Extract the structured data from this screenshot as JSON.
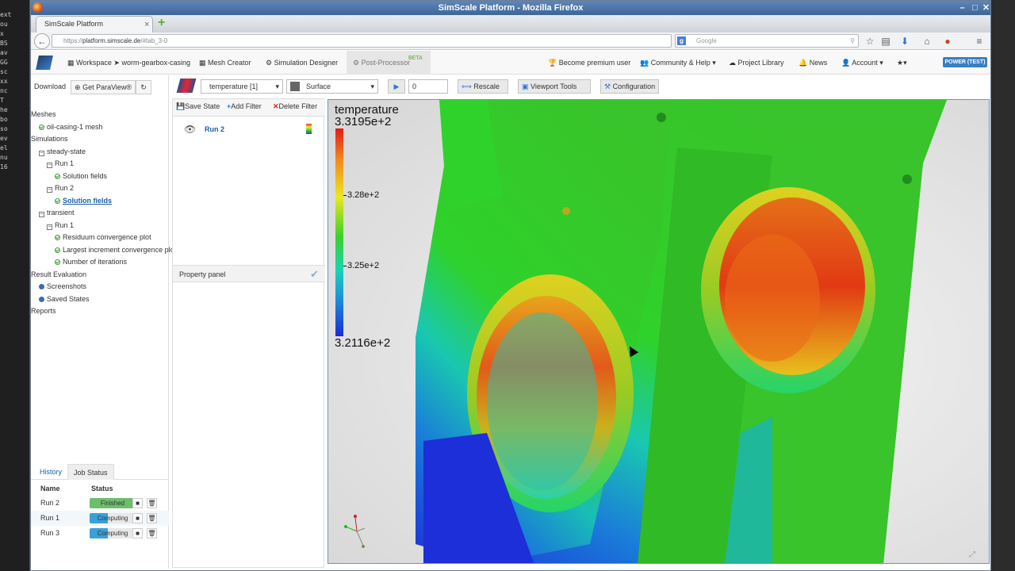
{
  "terminal_strip": {
    "lines": [
      "ext",
      "ou",
      "x",
      "BS",
      "av",
      "GG",
      "sc",
      "xx",
      "nc",
      "T",
      "he",
      "bo",
      "so",
      "ev",
      "el",
      "nu",
      "16"
    ]
  },
  "browser": {
    "window_title": "SimScale Platform - Mozilla Firefox",
    "tab_title": "SimScale Platform",
    "url_prefix": "https://",
    "url_domain": "platform.simscale.de",
    "url_path": "/#tab_3-0",
    "search_placeholder": "Google"
  },
  "app_nav": {
    "workspace_label": "Workspace",
    "arrow": "➤",
    "project_name": "worm-gearbox-casing",
    "mesh_creator": "Mesh Creator",
    "simulation_designer": "Simulation Designer",
    "post_processor": "Post-Processor",
    "beta_badge": "BETA",
    "premium": "Become premium user",
    "community": "Community & Help",
    "project_library": "Project Library",
    "news": "News",
    "account": "Account",
    "plan_badge": "POWER (TEST)"
  },
  "left_panel": {
    "download": "Download",
    "get_paraview": "Get ParaView®",
    "tree": [
      {
        "label": "Meshes",
        "indent": 0,
        "icon": "none"
      },
      {
        "label": "oil-casing-1 mesh",
        "indent": 1,
        "icon": "ok"
      },
      {
        "label": "Simulations",
        "indent": 0,
        "icon": "none"
      },
      {
        "label": "steady-state",
        "indent": 1,
        "icon": "minus"
      },
      {
        "label": "Run 1",
        "indent": 2,
        "icon": "minus"
      },
      {
        "label": "Solution fields",
        "indent": 3,
        "icon": "ok"
      },
      {
        "label": "Run 2",
        "indent": 2,
        "icon": "minus"
      },
      {
        "label": "Solution fields",
        "indent": 3,
        "icon": "ok",
        "selected": true
      },
      {
        "label": "transient",
        "indent": 1,
        "icon": "minus"
      },
      {
        "label": "Run 1",
        "indent": 2,
        "icon": "minus"
      },
      {
        "label": "Residuum convergence plot",
        "indent": 3,
        "icon": "ok"
      },
      {
        "label": "Largest increment convergence plot",
        "indent": 3,
        "icon": "ok"
      },
      {
        "label": "Number of iterations",
        "indent": 3,
        "icon": "ok"
      },
      {
        "label": "Result Evaluation",
        "indent": 0,
        "icon": "none"
      },
      {
        "label": "Screenshots",
        "indent": 1,
        "icon": "dot"
      },
      {
        "label": "Saved States",
        "indent": 1,
        "icon": "dot"
      },
      {
        "label": "Reports",
        "indent": 0,
        "icon": "none"
      }
    ],
    "tabs": {
      "history": "History",
      "job_status": "Job Status"
    },
    "table_headers": {
      "name": "Name",
      "status": "Status"
    },
    "jobs": [
      {
        "name": "Run 2",
        "status": "Finished",
        "color": "#6cbf6a"
      },
      {
        "name": "Run 1",
        "status": "Computing",
        "color": "#3aa0d8"
      },
      {
        "name": "Run 3",
        "status": "Computing",
        "color": "#3aa0d8"
      }
    ]
  },
  "pipeline_panel": {
    "save_state": "Save State",
    "add_filter": "Add Filter",
    "delete_filter": "Delete Filter",
    "item": "Run 2",
    "property_panel": "Property panel"
  },
  "viewport_toolbar": {
    "field_select": "temperature [1]",
    "representation_select": "Surface",
    "time_value": "0",
    "rescale": "Rescale",
    "viewport_tools": "Viewport Tools",
    "configuration": "Configuration"
  },
  "legend": {
    "title": "temperature",
    "max": "3.3195e+2",
    "ticks": [
      {
        "label": "3.28e+2",
        "pos": 0.32
      },
      {
        "label": "3.25e+2",
        "pos": 0.66
      }
    ],
    "min": "3.2116e+2"
  }
}
